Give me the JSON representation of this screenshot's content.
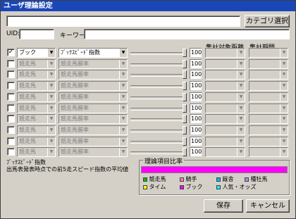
{
  "window": {
    "title": "ユーザ理論設定"
  },
  "top": {
    "category_button": "カテゴリ選択",
    "uid_label": "UID:",
    "keyword_label": "キーワード:",
    "name_value": "",
    "uid_value": "",
    "keyword_value": ""
  },
  "headers": {
    "distance": "集計対象距離",
    "period": "集計期間"
  },
  "rows": [
    {
      "checked": "✓",
      "enabled": true,
      "cat": "ブック",
      "item": "ﾌﾞｯｸｽﾋﾟｰﾄﾞ指数",
      "num": "100"
    },
    {
      "checked": "",
      "enabled": false,
      "cat": "競走馬",
      "item": "競走馬勝率",
      "num": "100"
    },
    {
      "checked": "",
      "enabled": false,
      "cat": "競走馬",
      "item": "競走馬勝率",
      "num": "100"
    },
    {
      "checked": "",
      "enabled": false,
      "cat": "競走馬",
      "item": "競走馬勝率",
      "num": "100"
    },
    {
      "checked": "",
      "enabled": false,
      "cat": "競走馬",
      "item": "競走馬勝率",
      "num": "100"
    },
    {
      "checked": "",
      "enabled": false,
      "cat": "競走馬",
      "item": "競走馬勝率",
      "num": "100"
    },
    {
      "checked": "",
      "enabled": false,
      "cat": "競走馬",
      "item": "競走馬勝率",
      "num": "100"
    },
    {
      "checked": "",
      "enabled": false,
      "cat": "競走馬",
      "item": "競走馬勝率",
      "num": "100"
    },
    {
      "checked": "",
      "enabled": false,
      "cat": "競走馬",
      "item": "競走馬勝率",
      "num": "100"
    },
    {
      "checked": "",
      "enabled": false,
      "cat": "競走馬",
      "item": "競走馬勝率",
      "num": "100"
    }
  ],
  "description": {
    "title": "ﾌﾞｯｸｽﾋﾟｰﾄﾞ指数",
    "body": "出馬表発表時点での前5走スピード指数の平均値"
  },
  "ratio": {
    "title": "理論項目比率",
    "bar_color": "#ff00ff",
    "bar_fraction": 1.0,
    "legend": [
      {
        "label": "競走馬",
        "color": "#00c000"
      },
      {
        "label": "騎手",
        "color": "#ff80c0"
      },
      {
        "label": "厩舎",
        "color": "#00c0ff"
      },
      {
        "label": "種牡馬",
        "color": "#c080ff"
      },
      {
        "label": "タイム",
        "color": "#ffff00"
      },
      {
        "label": "ブック",
        "color": "#ff00ff"
      },
      {
        "label": "人気・オッズ",
        "color": "#00ffff"
      }
    ]
  },
  "buttons": {
    "save": "保存",
    "cancel": "キャンセル"
  }
}
